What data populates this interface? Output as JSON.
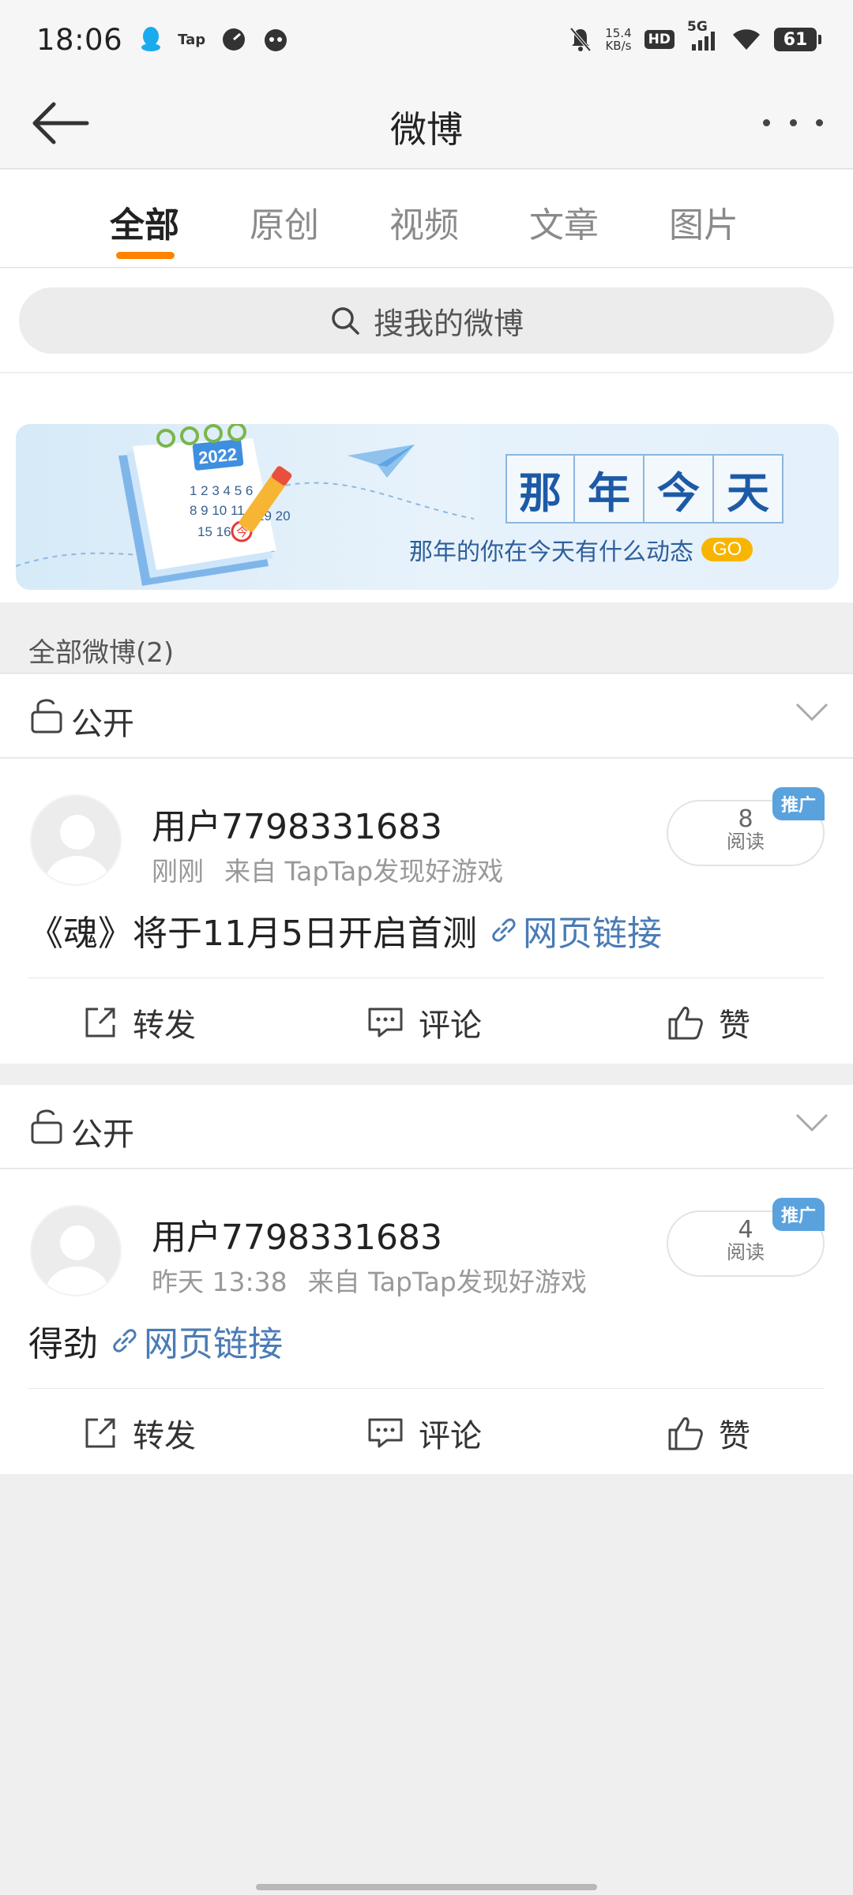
{
  "status_bar": {
    "time": "18:06",
    "tap_label": "Tap",
    "net_speed_value": "15.4",
    "net_speed_unit": "KB/s",
    "hd_label": "HD",
    "network_label": "5G",
    "battery": "61",
    "icons": [
      "qq-icon",
      "taptap-icon",
      "speedometer-icon",
      "game-icon",
      "mute-bell-icon",
      "signal-icon",
      "wifi-icon",
      "battery-icon"
    ]
  },
  "header": {
    "title": "微博",
    "back_icon": "back-arrow-icon",
    "more_icon": "more-dots-icon"
  },
  "tabs": [
    {
      "label": "全部",
      "active": true
    },
    {
      "label": "原创",
      "active": false
    },
    {
      "label": "视频",
      "active": false
    },
    {
      "label": "文章",
      "active": false
    },
    {
      "label": "图片",
      "active": false
    }
  ],
  "accent_color": "#ff8200",
  "search": {
    "placeholder": "搜我的微博"
  },
  "banner": {
    "title_chars": [
      "那",
      "年",
      "今",
      "天"
    ],
    "subtitle": "那年的你在今天有什么动态",
    "go_label": "GO",
    "calendar_year": "2022",
    "calendar_mark": "今"
  },
  "section": {
    "title": "全部微博(2)"
  },
  "posts": [
    {
      "visibility": "公开",
      "username": "用户7798331683",
      "time": "刚刚",
      "source": "来自 TapTap发现好游戏",
      "read_count": "8",
      "read_label": "阅读",
      "promo_label": "推广",
      "text": "《魂》将于11月5日开启首测",
      "link_label": "网页链接",
      "actions": {
        "repost": "转发",
        "comment": "评论",
        "like": "赞"
      }
    },
    {
      "visibility": "公开",
      "username": "用户7798331683",
      "time": "昨天 13:38",
      "source": "来自 TapTap发现好游戏",
      "read_count": "4",
      "read_label": "阅读",
      "promo_label": "推广",
      "text": "得劲",
      "link_label": "网页链接",
      "actions": {
        "repost": "转发",
        "comment": "评论",
        "like": "赞"
      }
    }
  ]
}
